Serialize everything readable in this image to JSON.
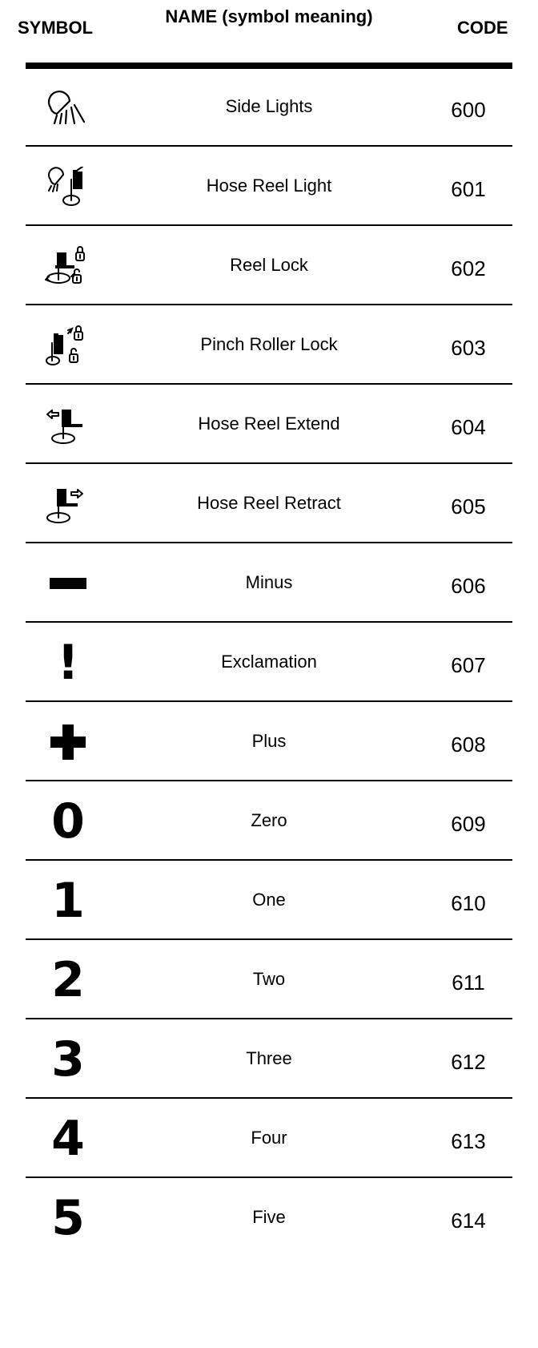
{
  "table": {
    "headers": {
      "symbol": "SYMBOL",
      "name": "NAME (symbol meaning)",
      "code": "CODE"
    },
    "rows": [
      {
        "icon": "side-lights-icon",
        "name": "Side Lights",
        "code": "600"
      },
      {
        "icon": "hose-reel-light-icon",
        "name": "Hose Reel Light",
        "code": "601"
      },
      {
        "icon": "reel-lock-icon",
        "name": "Reel Lock",
        "code": "602"
      },
      {
        "icon": "pinch-roller-lock-icon",
        "name": "Pinch Roller Lock",
        "code": "603"
      },
      {
        "icon": "hose-reel-extend-icon",
        "name": "Hose Reel Extend",
        "code": "604"
      },
      {
        "icon": "hose-reel-retract-icon",
        "name": "Hose Reel Retract",
        "code": "605"
      },
      {
        "icon": "minus-icon",
        "name": "Minus",
        "code": "606"
      },
      {
        "icon": "exclamation-icon",
        "name": "Exclamation",
        "code": "607",
        "glyph": "!"
      },
      {
        "icon": "plus-icon",
        "name": "Plus",
        "code": "608"
      },
      {
        "icon": "zero-icon",
        "name": "Zero",
        "code": "609",
        "glyph": "0"
      },
      {
        "icon": "one-icon",
        "name": "One",
        "code": "610",
        "glyph": "1"
      },
      {
        "icon": "two-icon",
        "name": "Two",
        "code": "611",
        "glyph": "2"
      },
      {
        "icon": "three-icon",
        "name": "Three",
        "code": "612",
        "glyph": "3"
      },
      {
        "icon": "four-icon",
        "name": "Four",
        "code": "613",
        "glyph": "4"
      },
      {
        "icon": "five-icon",
        "name": "Five",
        "code": "614",
        "glyph": "5"
      }
    ]
  }
}
